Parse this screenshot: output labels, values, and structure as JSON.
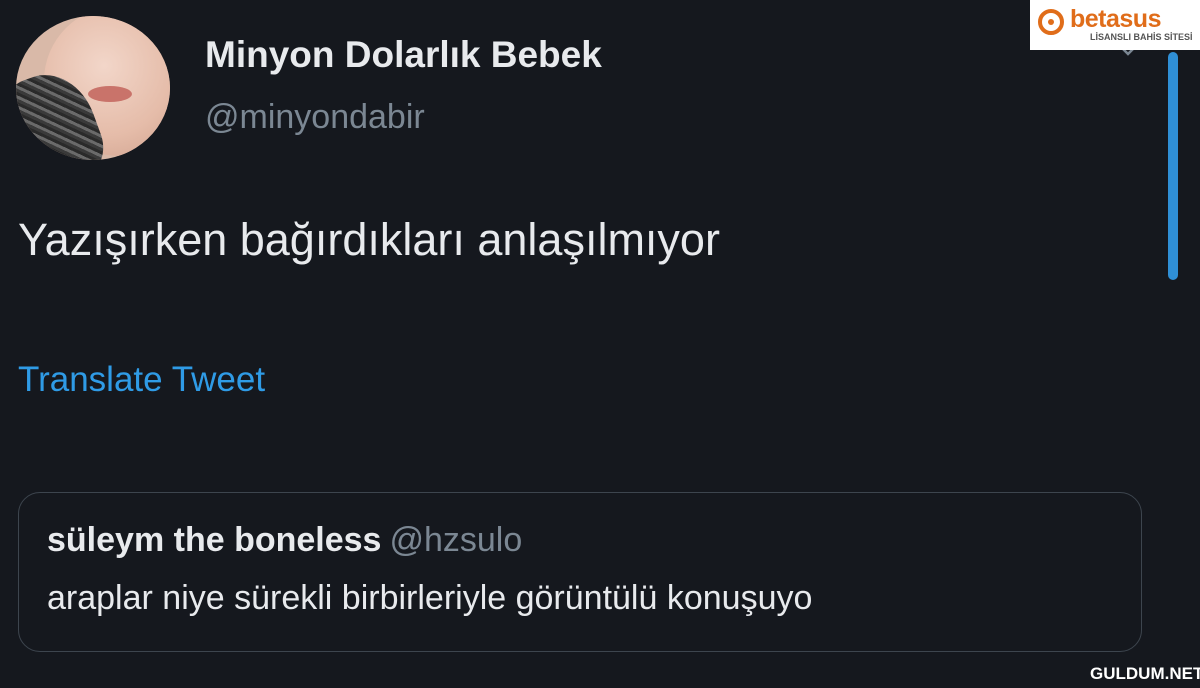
{
  "tweet": {
    "display_name": "Minyon Dolarlık Bebek",
    "handle": "@minyondabir",
    "text": "Yazışırken bağırdıkları anlaşılmıyor",
    "translate_label": "Translate Tweet"
  },
  "quoted_tweet": {
    "display_name": "süleym the boneless",
    "handle": "@hzsulo",
    "text": "araplar niye sürekli birbirleriyle görüntülü konuşuyo"
  },
  "logo": {
    "brand": "betasus",
    "tagline": "LİSANSLI BAHİS SİTESİ"
  },
  "watermark": "GULDUM.NET",
  "icons": {
    "menu": "chevron-down-icon",
    "logo": "betasus-logo-icon"
  },
  "colors": {
    "background": "#15181e",
    "link": "#2f9be6",
    "muted": "#7b8793",
    "logo_accent": "#e06d1a"
  }
}
